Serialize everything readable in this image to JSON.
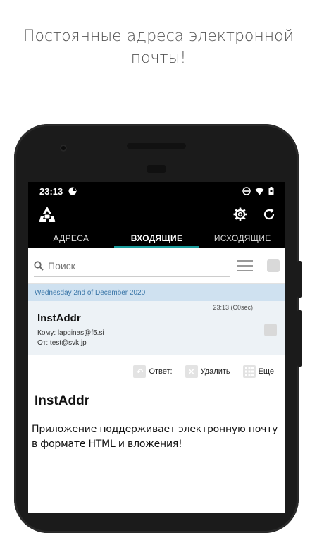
{
  "headline": {
    "line1": "Постоянные адреса электронной",
    "line2": "почты!"
  },
  "status_bar": {
    "time": "23:13"
  },
  "app_bar": {
    "logo_icon": "recycle-icon",
    "settings_icon": "gear-icon",
    "refresh_icon": "refresh-icon"
  },
  "tabs": [
    {
      "label": "АДРЕСА",
      "active": false
    },
    {
      "label": "ВХОДЯЩИЕ",
      "active": true
    },
    {
      "label": "ИСХОДЯЩИЕ",
      "active": false
    }
  ],
  "search": {
    "placeholder": "Поиск"
  },
  "date_header": "Wednesday 2nd of December 2020",
  "mail_item": {
    "time": "23:13 (C0sec)",
    "sender": "InstAddr",
    "to": "Кому: lapginas@f5.si",
    "from": "От: test@svk.jp"
  },
  "actions": {
    "reply": "Ответ:",
    "delete": "Удалить",
    "more": "Еще"
  },
  "message": {
    "subject": "InstAddr",
    "body": "Приложение поддерживает электронную почту в формате HTML и вложения!"
  },
  "colors": {
    "tab_indicator": "#1a9c9c",
    "date_bar_bg": "#cfe1f0",
    "date_bar_text": "#3a76a8"
  }
}
